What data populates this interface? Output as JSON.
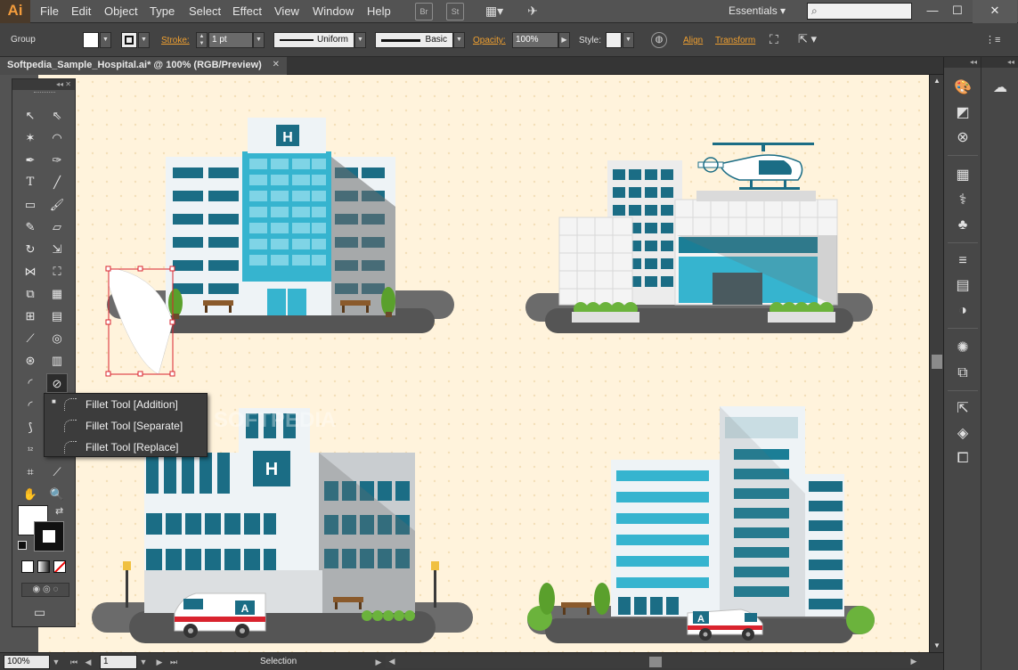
{
  "app": {
    "logo": "Ai",
    "menu": [
      "File",
      "Edit",
      "Object",
      "Type",
      "Select",
      "Effect",
      "View",
      "Window",
      "Help"
    ],
    "bridge_icon": "Br",
    "stock_icon": "St",
    "workspace": "Essentials",
    "search_placeholder": ""
  },
  "control_bar": {
    "selection_type": "Group",
    "stroke_label": "Stroke:",
    "stroke_weight": "1 pt",
    "profile_label": "Uniform",
    "brush_label": "Basic",
    "opacity_label": "Opacity:",
    "opacity_value": "100%",
    "style_label": "Style:",
    "align_label": "Align",
    "transform_label": "Transform"
  },
  "document": {
    "tab_title": "Softpedia_Sample_Hospital.ai* @ 100% (RGB/Preview)",
    "watermark": "SOFTPEDIA"
  },
  "building_signs": {
    "hospital_top_left": "H",
    "hospital_bottom_left": "H",
    "ambulance_1": "A",
    "ambulance_2": "A"
  },
  "tool_flyout": {
    "items": [
      {
        "label": "Fillet Tool [Addition]",
        "selected": true
      },
      {
        "label": "Fillet Tool [Separate]",
        "selected": false
      },
      {
        "label": "Fillet Tool [Replace]",
        "selected": false
      }
    ]
  },
  "status_bar": {
    "zoom": "100%",
    "artboard": "1",
    "status": "Selection"
  },
  "colors": {
    "artboard_bg": "#fff3dc",
    "teal": "#1b7e96",
    "teal_light": "#36b4cf",
    "accent_orange": "#f0a030",
    "ground": "#555555"
  }
}
